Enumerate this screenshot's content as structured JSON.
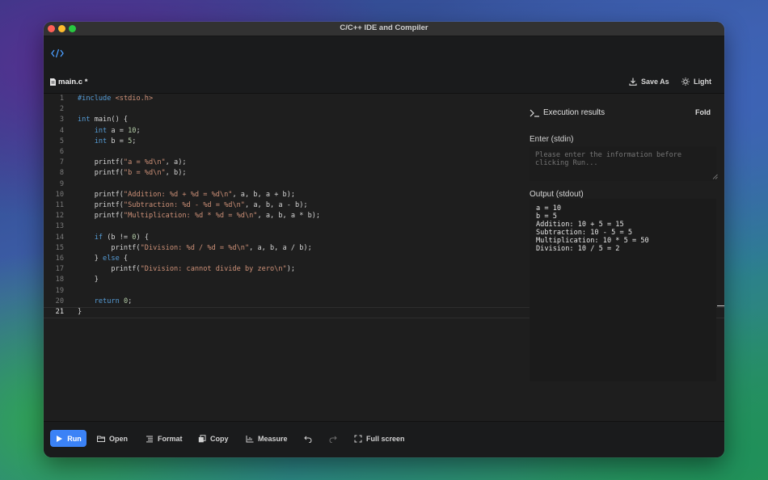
{
  "window": {
    "title": "C/C++ IDE and Compiler"
  },
  "file_tab": {
    "name": "main.c *"
  },
  "header_actions": {
    "save_as": "Save As",
    "theme": "Light"
  },
  "editor": {
    "active_line": 21,
    "line_numbers": [
      "1",
      "2",
      "3",
      "4",
      "5",
      "6",
      "7",
      "8",
      "9",
      "10",
      "11",
      "12",
      "13",
      "14",
      "15",
      "16",
      "17",
      "18",
      "19",
      "20",
      "21"
    ]
  },
  "results": {
    "title": "Execution results",
    "fold": "Fold",
    "stdin_label": "Enter (stdin)",
    "stdin_placeholder": "Please enter the information before clicking Run...",
    "stdout_label": "Output (stdout)",
    "stdout": "a = 10\nb = 5\nAddition: 10 + 5 = 15\nSubtraction: 10 - 5 = 5\nMultiplication: 10 * 5 = 50\nDivision: 10 / 5 = 2"
  },
  "toolbar": {
    "run": "Run",
    "open": "Open",
    "format": "Format",
    "copy": "Copy",
    "measure": "Measure",
    "full_screen": "Full screen"
  },
  "colors": {
    "accent": "#3b82f6",
    "keyword": "#569cd6",
    "string": "#ce9178",
    "number": "#b5cea8",
    "editor_bg": "#1e1e1e"
  },
  "icons": {
    "logo": "code-brackets-icon",
    "file": "file-icon",
    "save_as": "download-icon",
    "theme": "sun-icon",
    "terminal": "terminal-icon",
    "run": "play-icon",
    "open": "folder-icon",
    "format": "format-lines-icon",
    "copy": "copy-icon",
    "measure": "chart-icon",
    "undo": "undo-icon",
    "redo": "redo-icon",
    "full_screen": "expand-icon"
  }
}
